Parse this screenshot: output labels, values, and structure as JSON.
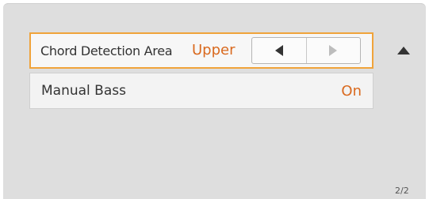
{
  "settings": {
    "chord_detection_area": {
      "label": "Chord Detection Area",
      "value": "Upper",
      "decrement_icon": "triangle-left-icon",
      "increment_icon": "triangle-right-icon"
    },
    "manual_bass": {
      "label": "Manual Bass",
      "value": "On"
    }
  },
  "scroll": {
    "up_icon": "triangle-up-icon"
  },
  "page_indicator": "2/2",
  "colors": {
    "highlight_border": "#f0a33a",
    "value_text": "#d9691e",
    "panel_bg": "#dedede",
    "row_bg": "#f3f3f3"
  }
}
